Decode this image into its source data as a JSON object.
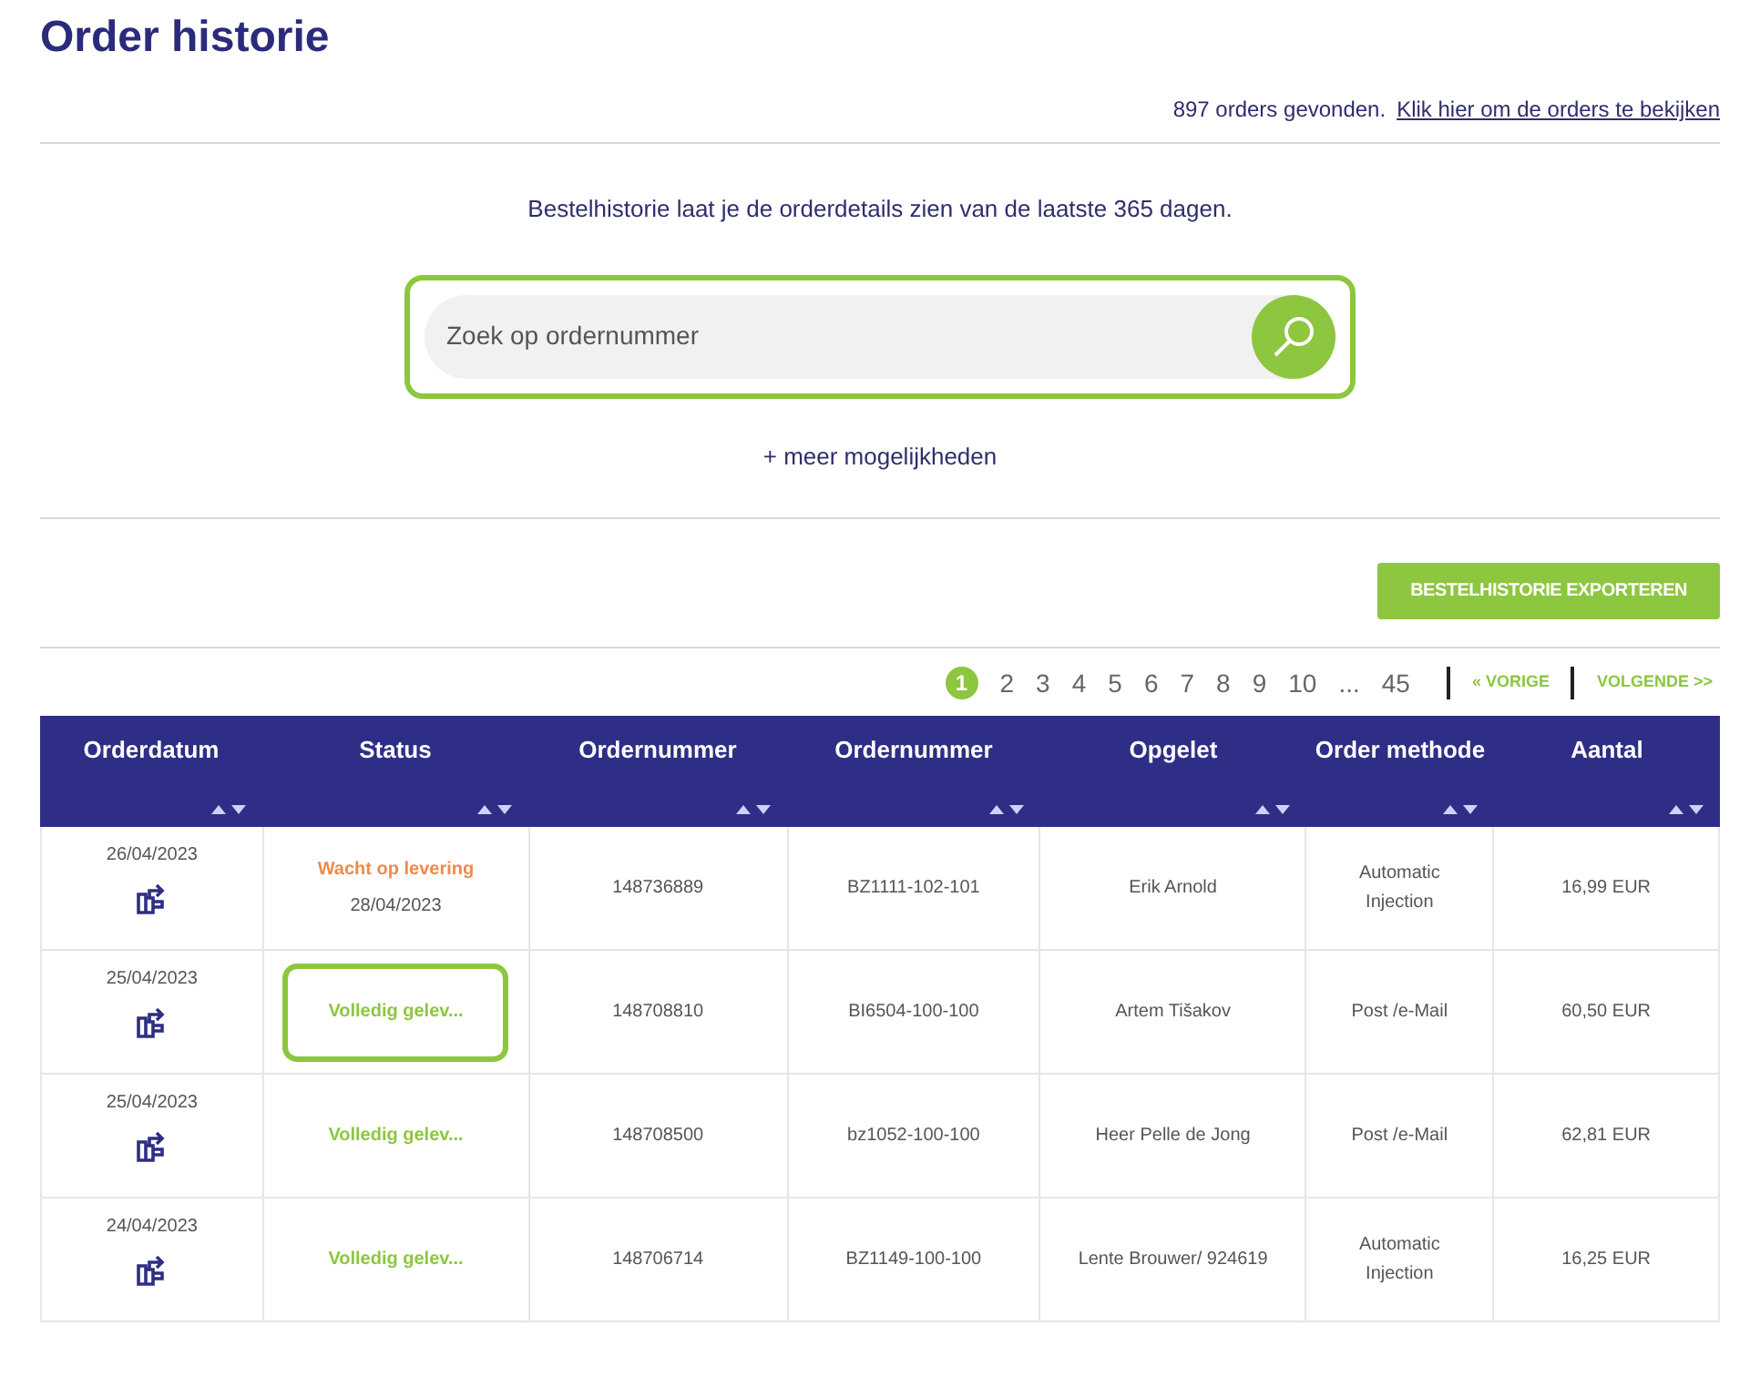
{
  "title": "Order historie",
  "summary": {
    "count_text": "897 orders gevonden.",
    "link": "Klik hier om de orders te bekijken"
  },
  "intro": "Bestelhistorie laat je de orderdetails zien van de laatste 365 dagen.",
  "search": {
    "placeholder": "Zoek op ordernummer",
    "highlighted": true
  },
  "more_options": "+ meer mogelijkheden",
  "export_button": "BESTELHISTORIE EXPORTEREN",
  "pagination": {
    "pages": [
      {
        "label": "1",
        "selected": true
      },
      {
        "label": "2",
        "selected": false
      },
      {
        "label": "3",
        "selected": false
      },
      {
        "label": "4",
        "selected": false
      },
      {
        "label": "5",
        "selected": false
      },
      {
        "label": "6",
        "selected": false
      },
      {
        "label": "7",
        "selected": false
      },
      {
        "label": "8",
        "selected": false
      },
      {
        "label": "9",
        "selected": false
      },
      {
        "label": "10",
        "selected": false
      },
      {
        "label": "...",
        "selected": false
      },
      {
        "label": "45",
        "selected": false
      }
    ],
    "previous": "« VORIGE",
    "next": "VOLGENDE >>"
  },
  "table": {
    "columns": [
      "Orderdatum",
      "Status",
      "Ordernummer",
      "Ordernummer",
      "Opgelet",
      "Order methode",
      "Aantal"
    ],
    "rows": [
      {
        "date": "26/04/2023",
        "status": {
          "kind": "waiting",
          "label": "Wacht op levering",
          "date": "28/04/2023",
          "highlighted": false
        },
        "order_number": "148736889",
        "order_ref": "BZ1111-102-101",
        "note": "Erik Arnold",
        "method": "Automatic Injection",
        "amount": "16,99 EUR"
      },
      {
        "date": "25/04/2023",
        "status": {
          "kind": "delivered",
          "label": "Volledig gelev...",
          "highlighted": true
        },
        "order_number": "148708810",
        "order_ref": "BI6504-100-100",
        "note": "Artem Tišakov",
        "method": "Post /e-Mail",
        "amount": "60,50 EUR"
      },
      {
        "date": "25/04/2023",
        "status": {
          "kind": "delivered",
          "label": "Volledig gelev...",
          "highlighted": false
        },
        "order_number": "148708500",
        "order_ref": "bz1052-100-100",
        "note": "Heer Pelle de Jong",
        "method": "Post /e-Mail",
        "amount": "62,81 EUR"
      },
      {
        "date": "24/04/2023",
        "status": {
          "kind": "delivered",
          "label": "Volledig gelev...",
          "highlighted": false
        },
        "order_number": "148706714",
        "order_ref": "BZ1149-100-100",
        "note": "Lente Brouwer/ 924619",
        "method": "Automatic Injection",
        "amount": "16,25 EUR"
      }
    ]
  }
}
